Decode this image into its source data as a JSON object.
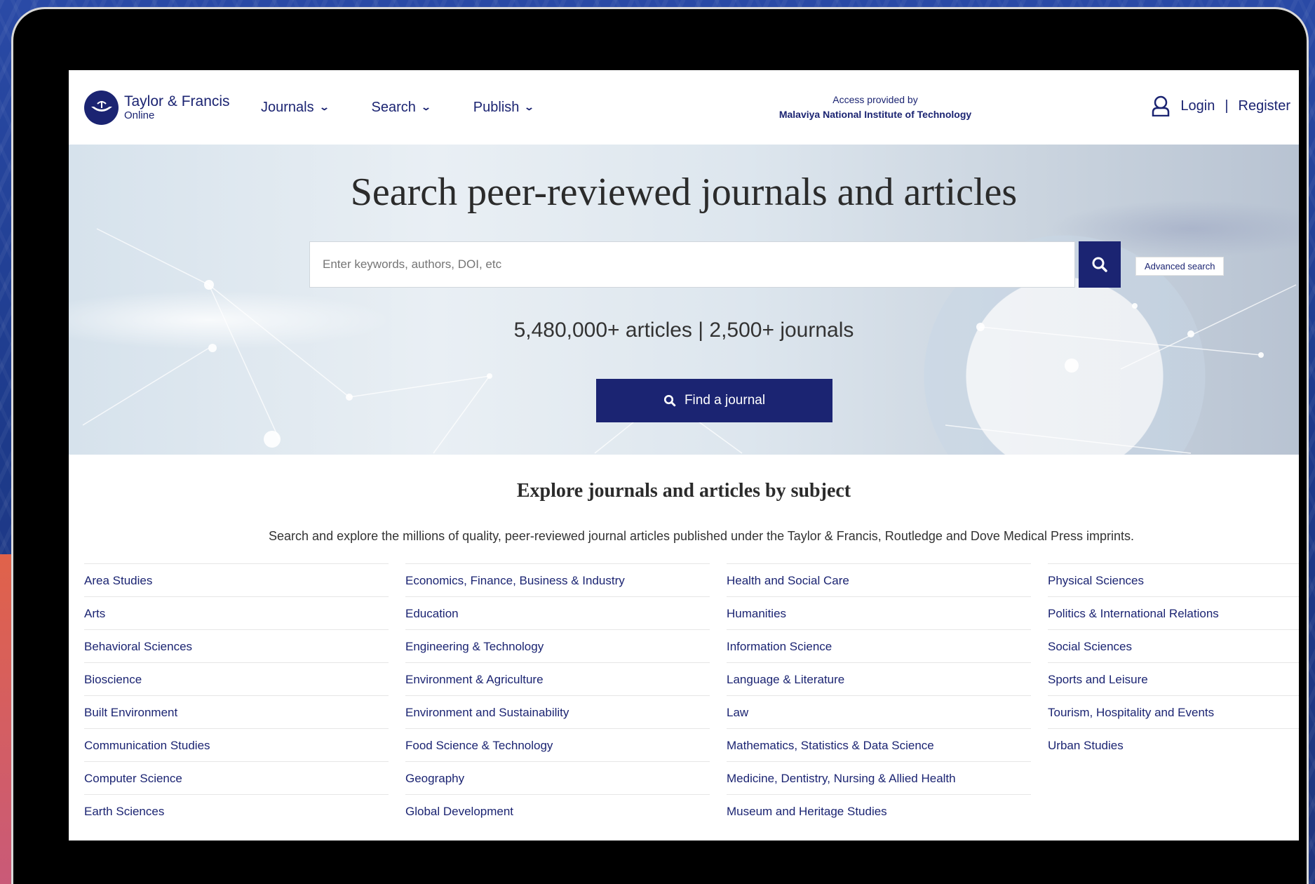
{
  "header": {
    "logo_title": "Taylor & Francis",
    "logo_sub": "Online",
    "nav": [
      {
        "label": "Journals"
      },
      {
        "label": "Search"
      },
      {
        "label": "Publish"
      }
    ],
    "access_label": "Access provided by",
    "access_institution": "Malaviya National Institute of Technology",
    "login": "Login",
    "separator": "|",
    "register": "Register"
  },
  "hero": {
    "title": "Search peer-reviewed journals and articles",
    "search_placeholder": "Enter keywords, authors, DOI, etc",
    "advanced_search": "Advanced search",
    "stats": "5,480,000+ articles | 2,500+ journals",
    "find_journal": "Find a journal"
  },
  "explore": {
    "title": "Explore journals and articles by subject",
    "description": "Search and explore the millions of quality, peer-reviewed journal articles published under the Taylor & Francis, Routledge and Dove Medical Press imprints.",
    "columns": [
      [
        "Area Studies",
        "Arts",
        "Behavioral Sciences",
        "Bioscience",
        "Built Environment",
        "Communication Studies",
        "Computer Science",
        "Earth Sciences"
      ],
      [
        "Economics, Finance, Business & Industry",
        "Education",
        "Engineering & Technology",
        "Environment & Agriculture",
        "Environment and Sustainability",
        "Food Science & Technology",
        "Geography",
        "Global Development"
      ],
      [
        "Health and Social Care",
        "Humanities",
        "Information Science",
        "Language & Literature",
        "Law",
        "Mathematics, Statistics & Data Science",
        "Medicine, Dentistry, Nursing & Allied Health",
        "Museum and Heritage Studies"
      ],
      [
        "Physical Sciences",
        "Politics & International Relations",
        "Social Sciences",
        "Sports and Leisure",
        "Tourism, Hospitality and Events",
        "Urban Studies"
      ]
    ]
  },
  "colors": {
    "brand": "#1b2472",
    "frame": "#000000",
    "background": "#1f3f8f"
  },
  "icons": [
    "logo-icon",
    "chevron-down-icon",
    "user-icon",
    "search-icon"
  ]
}
